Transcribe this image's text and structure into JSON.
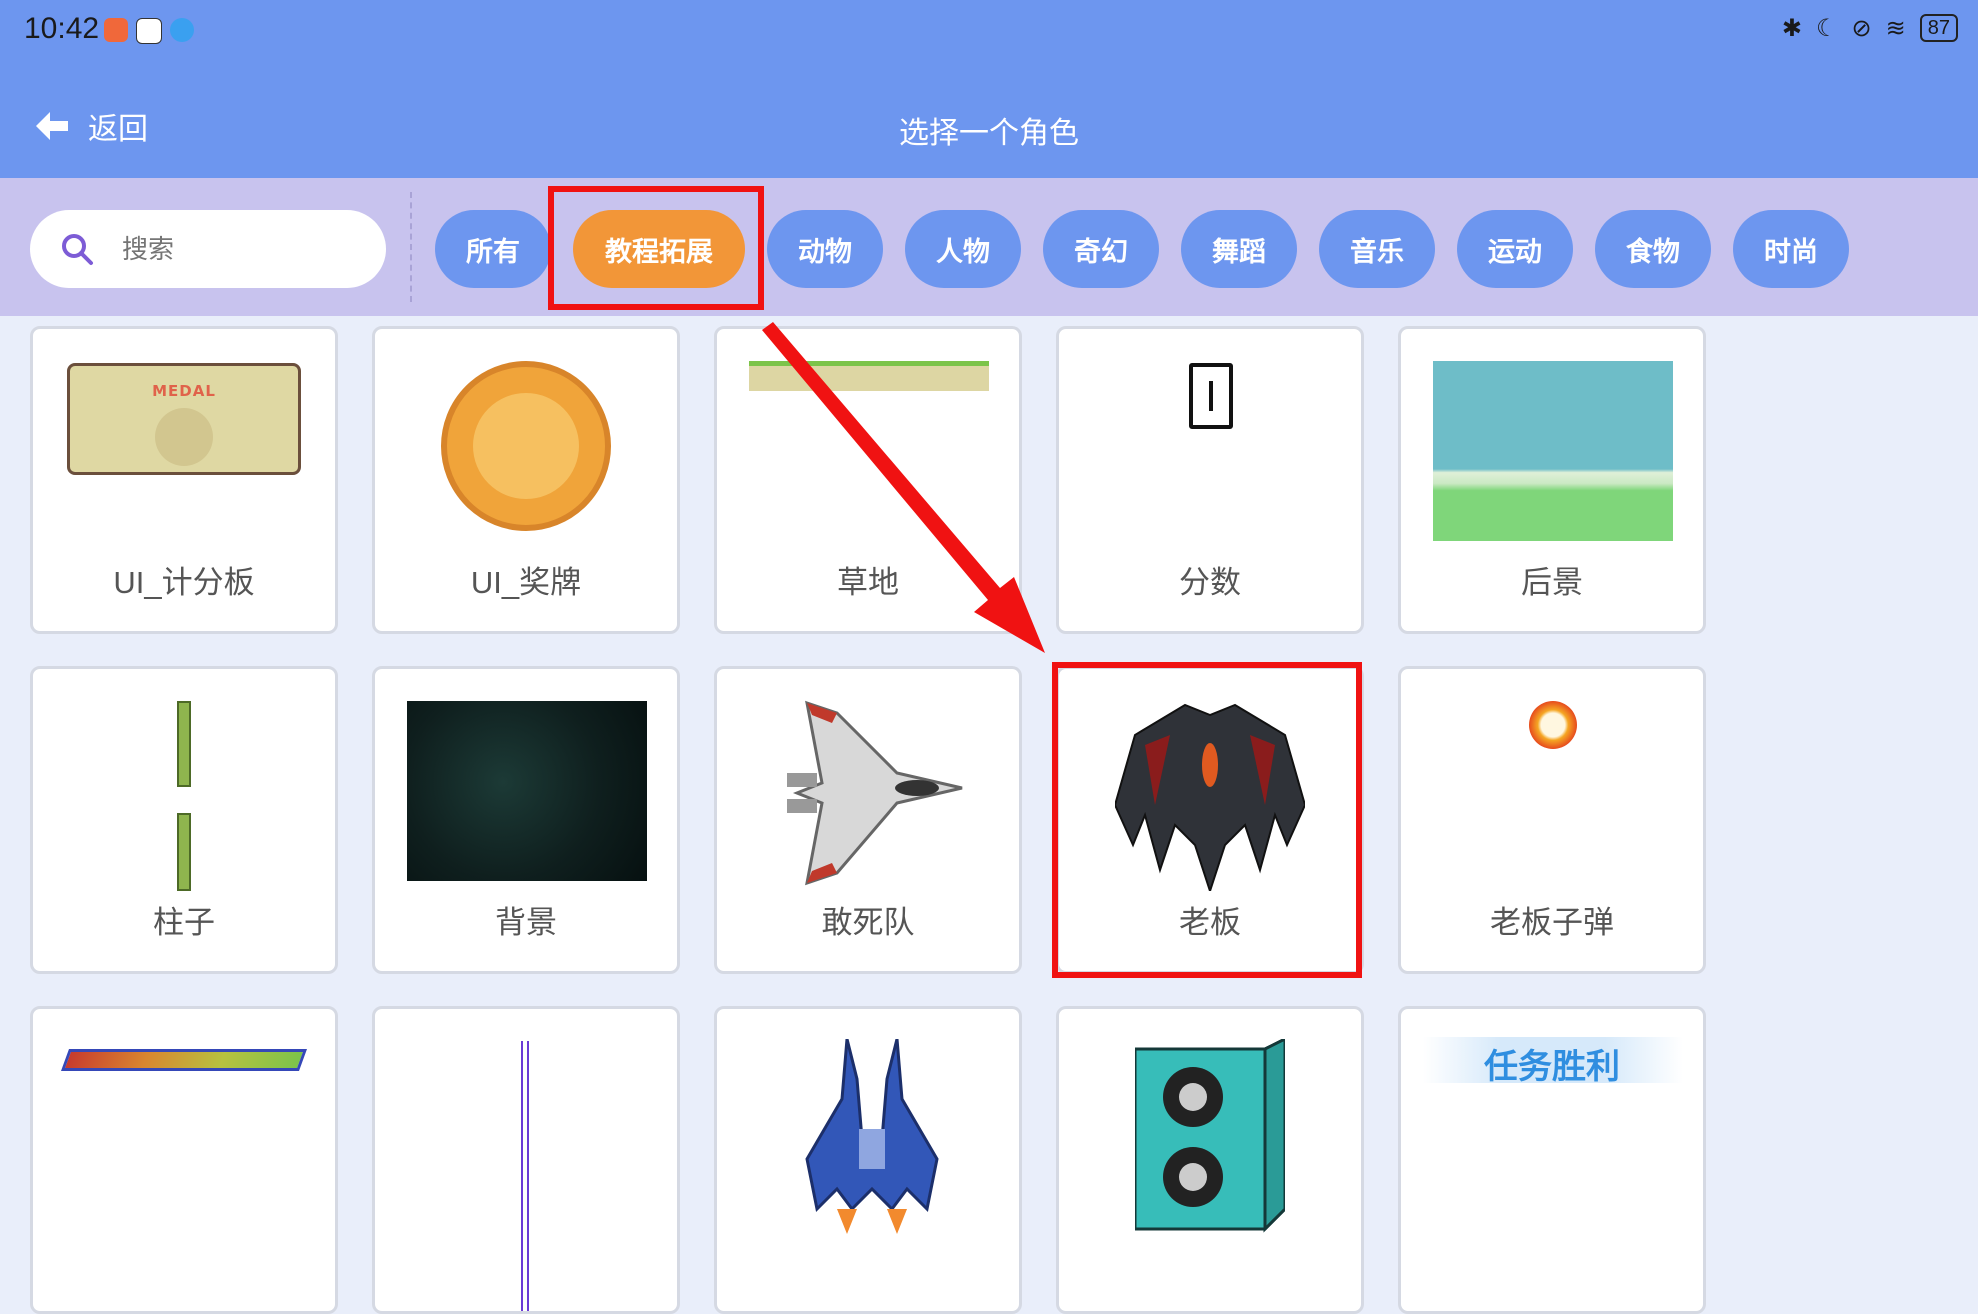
{
  "status_bar": {
    "time": "10:42",
    "battery": "87"
  },
  "header": {
    "back_label": "返回",
    "title": "选择一个角色"
  },
  "search": {
    "placeholder": "搜索"
  },
  "categories": [
    "所有",
    "教程拓展",
    "动物",
    "人物",
    "奇幻",
    "舞蹈",
    "音乐",
    "运动",
    "食物",
    "时尚"
  ],
  "active_category": "教程拓展",
  "sprites": [
    {
      "label": "UI_计分板",
      "thumb_text": "MEDAL"
    },
    {
      "label": "UI_奖牌"
    },
    {
      "label": "草地"
    },
    {
      "label": "分数"
    },
    {
      "label": "后景"
    },
    {
      "label": "柱子"
    },
    {
      "label": "背景"
    },
    {
      "label": "敢死队"
    },
    {
      "label": "老板"
    },
    {
      "label": "老板子弹"
    },
    {
      "label": ""
    },
    {
      "label": ""
    },
    {
      "label": ""
    },
    {
      "label": ""
    },
    {
      "label": "",
      "thumb_text": "任务胜利"
    }
  ],
  "highlighted_sprite": "老板",
  "colors": {
    "header": "#6d96ef",
    "filter_bar": "#c8c3ee",
    "chip": "#6d96ef",
    "chip_active": "#f29638",
    "highlight": "#f01212",
    "page_bg": "#e9eefa"
  }
}
